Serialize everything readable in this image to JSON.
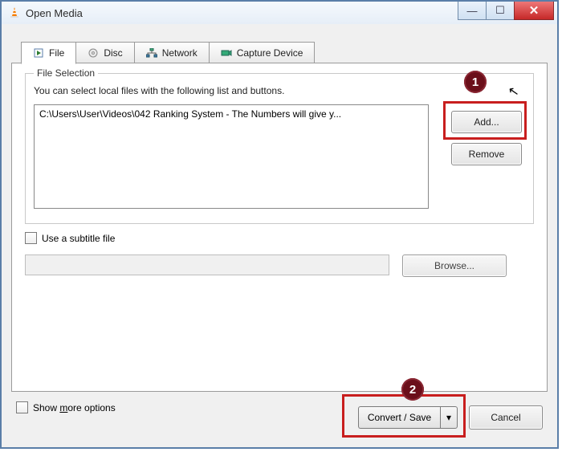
{
  "window": {
    "title": "Open Media"
  },
  "tabs": {
    "file": {
      "label": "File"
    },
    "disc": {
      "label": "Disc"
    },
    "network": {
      "label": "Network"
    },
    "capture": {
      "label": "Capture Device"
    }
  },
  "fileSelection": {
    "legend": "File Selection",
    "description": "You can select local files with the following list and buttons.",
    "items": [
      "C:\\Users\\User\\Videos\\042 Ranking System - The Numbers will give y..."
    ],
    "addLabel": "Add...",
    "removeLabel": "Remove"
  },
  "subtitle": {
    "checkboxLabel": "Use a subtitle file",
    "browseLabel": "Browse..."
  },
  "showMore": {
    "prefix": "Show ",
    "underlined": "m",
    "suffix": "ore options"
  },
  "footer": {
    "convertLabel": "Convert / Save",
    "cancelLabel": "Cancel"
  },
  "annotations": {
    "badge1": "1",
    "badge2": "2"
  }
}
